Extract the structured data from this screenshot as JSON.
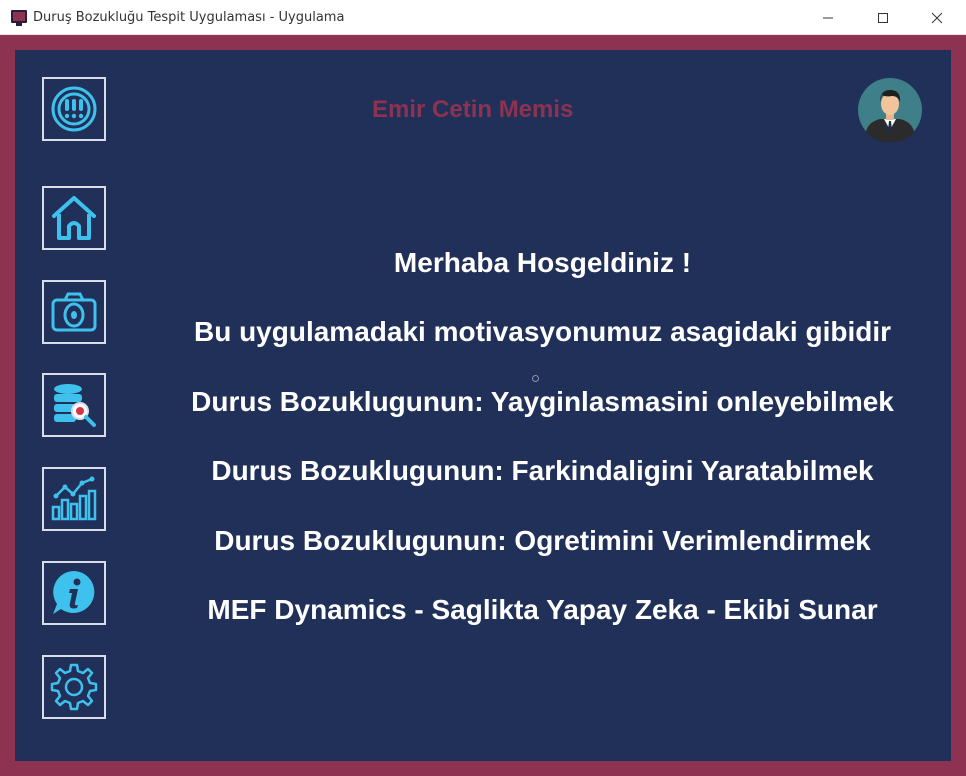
{
  "window": {
    "title": "Duruş Bozukluğu Tespit Uygulaması - Uygulama"
  },
  "header": {
    "username": "Emir Cetin Memis"
  },
  "sidebar": {
    "items": [
      {
        "name": "alert",
        "icon": "alert-circle-icon"
      },
      {
        "name": "home",
        "icon": "home-icon"
      },
      {
        "name": "camera",
        "icon": "camera-icon"
      },
      {
        "name": "database-search",
        "icon": "database-search-icon"
      },
      {
        "name": "statistics",
        "icon": "bar-chart-icon"
      },
      {
        "name": "info",
        "icon": "info-icon"
      },
      {
        "name": "settings",
        "icon": "gear-icon"
      }
    ]
  },
  "main": {
    "lines": [
      "Merhaba Hosgeldiniz !",
      "Bu uygulamadaki motivasyonumuz asagidaki gibidir",
      "Durus Bozuklugunun: Yayginlasmasini onleyebilmek",
      "Durus Bozuklugunun: Farkindaligini Yaratabilmek",
      "Durus Bozuklugunun: Ogretimini Verimlendirmek",
      "MEF Dynamics - Saglikta Yapay Zeka - Ekibi Sunar"
    ]
  },
  "colors": {
    "frame": "#8d3250",
    "panel": "#213058",
    "icon_blue": "#3ec1ec",
    "text": "#ffffff"
  }
}
